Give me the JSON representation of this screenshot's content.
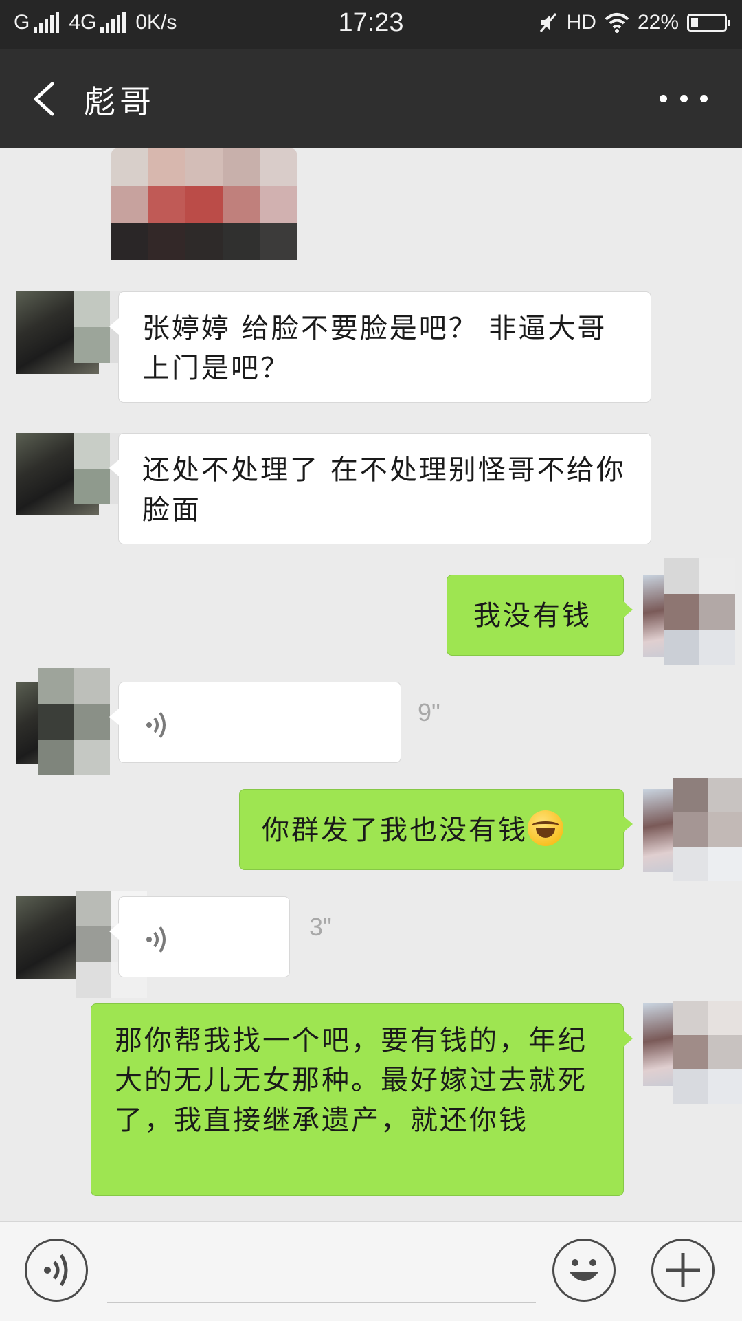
{
  "status_bar": {
    "network_1": "G",
    "network_2": "4G",
    "speed": "0K/s",
    "time": "17:23",
    "hd": "HD",
    "battery_percent": "22%",
    "battery_level": 0.22
  },
  "header": {
    "title": "彪哥"
  },
  "messages": [
    {
      "sender": "them",
      "type": "image"
    },
    {
      "sender": "them",
      "type": "text",
      "text": "张婷婷 给脸不要脸是吧？ 非逼大哥上门是吧？"
    },
    {
      "sender": "them",
      "type": "text",
      "text": "还处不处理了 在不处理别怪哥不给你脸面"
    },
    {
      "sender": "me",
      "type": "text",
      "text": "我没有钱"
    },
    {
      "sender": "them",
      "type": "voice",
      "duration": "9\""
    },
    {
      "sender": "me",
      "type": "text",
      "text": "你群发了我也没有钱",
      "emoji": "crying-laughing-emoji"
    },
    {
      "sender": "them",
      "type": "voice",
      "duration": "3\""
    },
    {
      "sender": "me",
      "type": "text",
      "text": "那你帮我找一个吧，要有钱的，年纪大的无儿无女那种。最好嫁过去就死了，我直接继承遗产，就还你钱"
    }
  ],
  "input_bar": {
    "voice_button_icon": "voice-icon",
    "emoji_button_icon": "emoji-icon",
    "add_button_icon": "plus-icon"
  }
}
